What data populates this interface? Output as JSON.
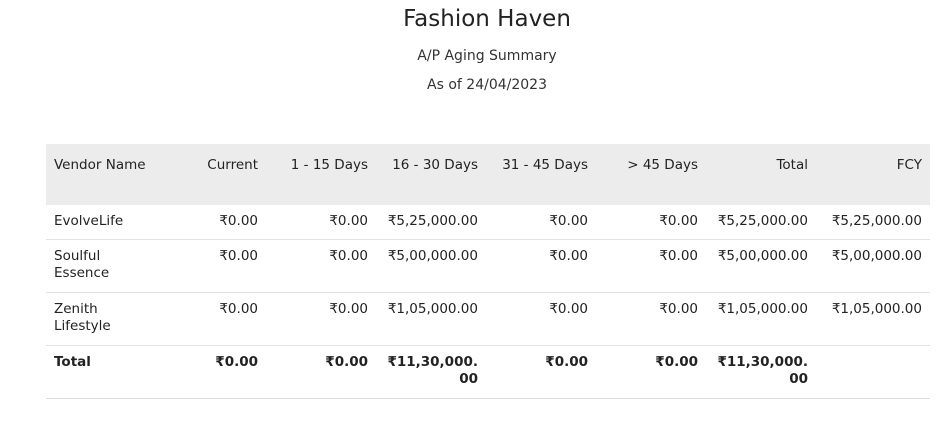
{
  "report": {
    "company": "Fashion Haven",
    "title": "A/P Aging Summary",
    "as_of": "As of 24/04/2023"
  },
  "table": {
    "columns": [
      "Vendor Name",
      "Current",
      "1 - 15 Days",
      "16 - 30 Days",
      "31 - 45 Days",
      "> 45 Days",
      "Total",
      "FCY"
    ],
    "rows": [
      {
        "vendor": "EvolveLife",
        "current": "₹0.00",
        "d1_15": "₹0.00",
        "d16_30": "₹5,25,000.00",
        "d31_45": "₹0.00",
        "d45": "₹0.00",
        "total": "₹5,25,000.00",
        "fcy": "₹5,25,000.00"
      },
      {
        "vendor": "Soulful Essence",
        "current": "₹0.00",
        "d1_15": "₹0.00",
        "d16_30": "₹5,00,000.00",
        "d31_45": "₹0.00",
        "d45": "₹0.00",
        "total": "₹5,00,000.00",
        "fcy": "₹5,00,000.00"
      },
      {
        "vendor": "Zenith Lifestyle",
        "current": "₹0.00",
        "d1_15": "₹0.00",
        "d16_30": "₹1,05,000.00",
        "d31_45": "₹0.00",
        "d45": "₹0.00",
        "total": "₹1,05,000.00",
        "fcy": "₹1,05,000.00"
      }
    ],
    "total_row": {
      "label": "Total",
      "current": "₹0.00",
      "d1_15": "₹0.00",
      "d16_30": "₹11,30,000.00",
      "d31_45": "₹0.00",
      "d45": "₹0.00",
      "total": "₹11,30,000.00",
      "fcy": ""
    }
  }
}
